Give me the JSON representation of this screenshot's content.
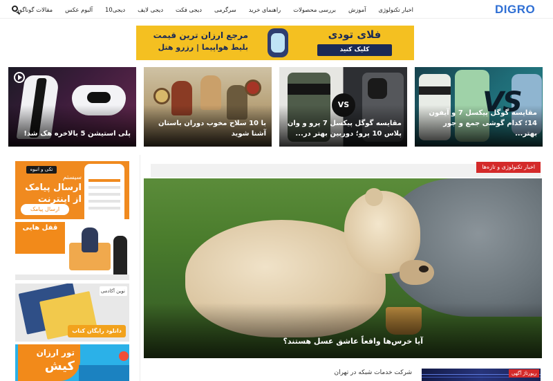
{
  "header": {
    "logo_text": "DIGRO",
    "nav": [
      "اخبار تکنولوژی",
      "آموزش",
      "بررسی محصولات",
      "راهنمای خرید",
      "سرگرمی",
      "دیجی فکت",
      "دیجی لایف",
      "دیجی10",
      "آلبوم عکس",
      "مقالات گوناگون"
    ],
    "search_icon": "search-icon"
  },
  "top_ad": {
    "line1": "مرجع ارزان ترین قیمت",
    "line2": "بلیط هواپیما | رزرو هتل",
    "brand": "فلای تودی",
    "cta": "کلیک کنید"
  },
  "featured": [
    {
      "title": "پلی استیشن 5 بالاخره هک شد!",
      "icon": "video-play-icon"
    },
    {
      "title": "با 10 سلاح مخوب دوران باستان آشنا شوید"
    },
    {
      "title": "مقایسه گوگل پیکسل 7 پرو و وان پلاس 10 پرو؛ دوربین بهتر در...",
      "badge": "VS"
    },
    {
      "title": "مقایسه گوگل پیکسل 7 و آیفون 14؛ کدام گوشی جمع و جور بهتر...",
      "badge": "VS"
    }
  ],
  "sidebar_ads": {
    "sms": {
      "tag": "تکی و انبوه",
      "line1": "سیستم",
      "line2": "ارسال پیامک",
      "line3": "از اینترنت",
      "cta": "ارسال پیامک"
    },
    "locks": {
      "title": "قفل هایی"
    },
    "books": {
      "brand": "نوین آکادمی",
      "cta": "دانلود رایگان کتاب"
    },
    "kish": {
      "line1": "تور ارزان",
      "line2": "کیش"
    }
  },
  "main": {
    "section_tag": "اخبار تکنولوژی و تازه‌ها",
    "hero_title": "آیا خرس‌ها واقعاً عاشق عسل هستند؟",
    "news_title": "شرکت خدمات شبکه در تهران",
    "report_badge": "رپورتاژ آگهی"
  }
}
